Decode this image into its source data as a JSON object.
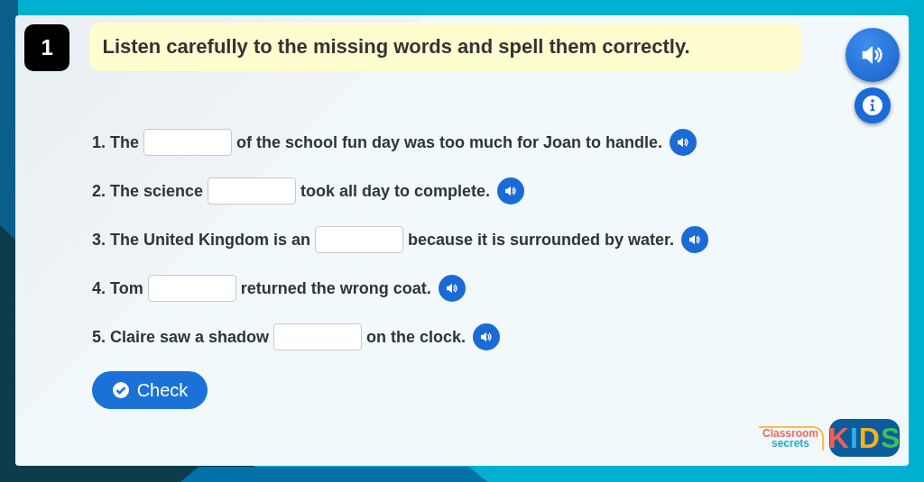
{
  "question_number": "1",
  "instruction": "Listen carefully to the missing words and spell them correctly.",
  "questions": [
    {
      "before": "1. The",
      "after": "of the school fun day was too much for Joan to handle."
    },
    {
      "before": "2. The science",
      "after": "took all day to complete."
    },
    {
      "before": "3. The United Kingdom is an",
      "after": "because it is surrounded by water."
    },
    {
      "before": "4. Tom",
      "after": "returned the wrong coat."
    },
    {
      "before": "5. Claire saw a shadow",
      "after": "on the clock."
    }
  ],
  "check_button": "Check",
  "logo": {
    "line_1": "Classroom",
    "line_2": "secrets",
    "badge": "KIDS"
  }
}
